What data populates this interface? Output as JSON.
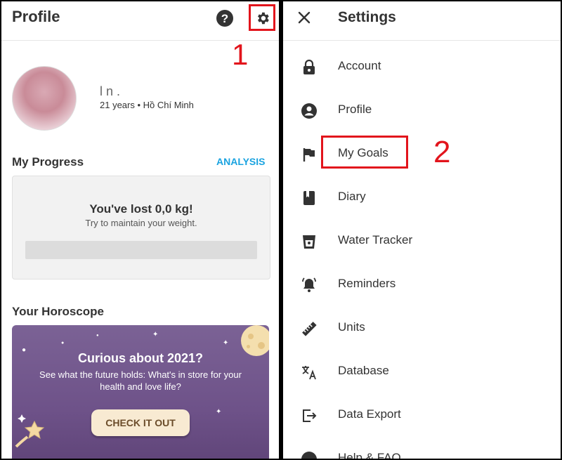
{
  "profile": {
    "title": "Profile",
    "user_name": "l   n .",
    "user_meta": "21 years • Hồ Chí Minh",
    "step_marker": "1"
  },
  "progress": {
    "section_title": "My Progress",
    "analysis_link": "ANALYSIS",
    "headline": "You've lost 0,0 kg!",
    "subtext": "Try to maintain your weight."
  },
  "horoscope": {
    "section_title": "Your Horoscope",
    "card_title": "Curious about 2021?",
    "card_text": "See what the future holds: What's in store for your health and love life?",
    "button_label": "CHECK IT OUT"
  },
  "settings": {
    "title": "Settings",
    "step_marker": "2",
    "items": [
      {
        "label": "Account",
        "icon": "lock-icon"
      },
      {
        "label": "Profile",
        "icon": "person-icon"
      },
      {
        "label": "My Goals",
        "icon": "flag-icon"
      },
      {
        "label": "Diary",
        "icon": "diary-icon"
      },
      {
        "label": "Water Tracker",
        "icon": "cup-icon"
      },
      {
        "label": "Reminders",
        "icon": "bell-icon"
      },
      {
        "label": "Units",
        "icon": "ruler-icon"
      },
      {
        "label": "Database",
        "icon": "translate-icon"
      },
      {
        "label": "Data Export",
        "icon": "export-icon"
      },
      {
        "label": "Help & FAQ",
        "icon": "help-icon"
      }
    ]
  },
  "colors": {
    "accent_blue": "#1aa3e0",
    "highlight_red": "#e2141c",
    "horoscope_purple": "#6e5289"
  }
}
